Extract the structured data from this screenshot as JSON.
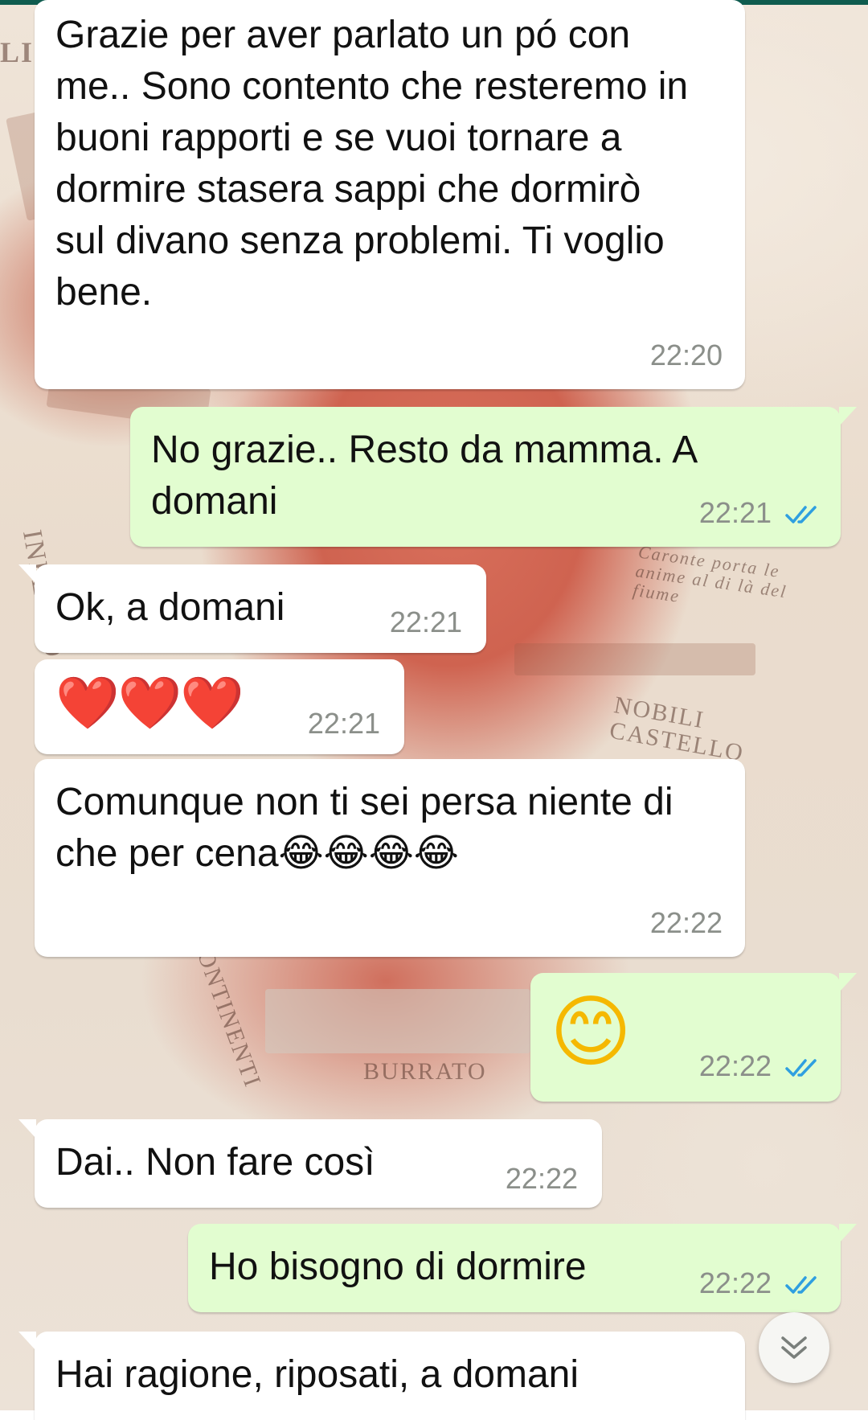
{
  "messages": [
    {
      "dir": "in",
      "text": "Grazie per aver parlato un pó con me.. Sono contento che resteremo in buoni rapporti e se vuoi tornare a dormire stasera sappi che dormirò sul divano senza problemi. Ti voglio bene.",
      "time": "22:20"
    },
    {
      "dir": "out",
      "text": "No grazie.. Resto da mamma. A domani",
      "time": "22:21",
      "status": "read"
    },
    {
      "dir": "in",
      "text": "Ok, a domani",
      "time": "22:21"
    },
    {
      "dir": "in",
      "text": "❤️❤️❤️",
      "time": "22:21"
    },
    {
      "dir": "in",
      "text": "Comunque non ti sei persa niente di che per cena😂😂😂😂",
      "time": "22:22"
    },
    {
      "dir": "out",
      "text": "😊",
      "time": "22:22",
      "status": "read"
    },
    {
      "dir": "in",
      "text": "Dai.. Non fare così",
      "time": "22:22"
    },
    {
      "dir": "out",
      "text": "Ho bisogno di dormire",
      "time": "22:22",
      "status": "read"
    },
    {
      "dir": "in",
      "text": "Hai ragione, riposati, a domani",
      "time": ""
    }
  ],
  "wallpaper_text": {
    "caronte": "Caronte porta le anime al di là del fiume",
    "nobili": "NOBILI CASTELLO",
    "burrato": "BURRATO",
    "left_top": "LI",
    "left_side": "INFERNO",
    "continenti": "CONTINENTI"
  },
  "colors": {
    "incoming_bubble": "#ffffff",
    "outgoing_bubble": "#e2fdd0",
    "read_ticks": "#2f9fe0",
    "time_text": "#8b8f8a"
  },
  "icons": {
    "read_receipt": "double-check-icon",
    "scroll_down": "chevron-double-down-icon"
  }
}
